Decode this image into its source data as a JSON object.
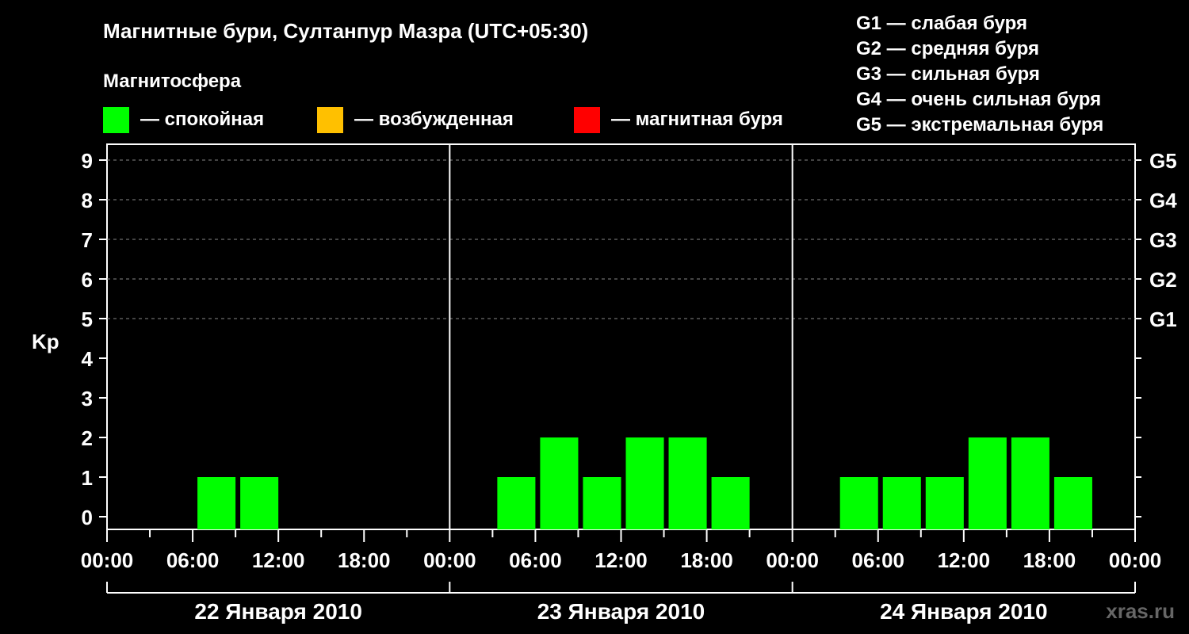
{
  "header": {
    "title": "Магнитные бури, Султанпур Мазра (UTC+05:30)",
    "subtitle": "Магнитосфера"
  },
  "legend": [
    {
      "label": "— спокойная",
      "color": "#00ff00"
    },
    {
      "label": "— возбужденная",
      "color": "#ffc000"
    },
    {
      "label": "— магнитная буря",
      "color": "#ff0000"
    }
  ],
  "g_legend": [
    "G1 — слабая буря",
    "G2 — средняя буря",
    "G3 — сильная буря",
    "G4 — очень сильная буря",
    "G5 — экстремальная буря"
  ],
  "watermark": "xras.ru",
  "chart_data": {
    "type": "bar",
    "ylabel": "Kp",
    "ylim": [
      0,
      9
    ],
    "yticks": [
      "0",
      "1",
      "2",
      "3",
      "4",
      "5",
      "6",
      "7",
      "8",
      "9"
    ],
    "g_levels": [
      {
        "label": "G1",
        "kp": 5
      },
      {
        "label": "G2",
        "kp": 6
      },
      {
        "label": "G3",
        "kp": 7
      },
      {
        "label": "G4",
        "kp": 8
      },
      {
        "label": "G5",
        "kp": 9
      }
    ],
    "xtick_labels": [
      "00:00",
      "06:00",
      "12:00",
      "18:00",
      "00:00",
      "06:00",
      "12:00",
      "18:00",
      "00:00",
      "06:00",
      "12:00",
      "18:00",
      "00:00"
    ],
    "days": [
      {
        "label": "22 Января 2010",
        "kp": [
          0,
          0,
          1,
          1,
          0,
          0,
          0,
          0
        ]
      },
      {
        "label": "23 Января 2010",
        "kp": [
          0,
          1,
          2,
          1,
          2,
          2,
          1,
          0
        ]
      },
      {
        "label": "24 Января 2010",
        "kp": [
          0,
          1,
          1,
          1,
          2,
          2,
          1,
          0
        ]
      }
    ],
    "grid": "dashed at G levels",
    "bar_color": "#00ff00"
  }
}
